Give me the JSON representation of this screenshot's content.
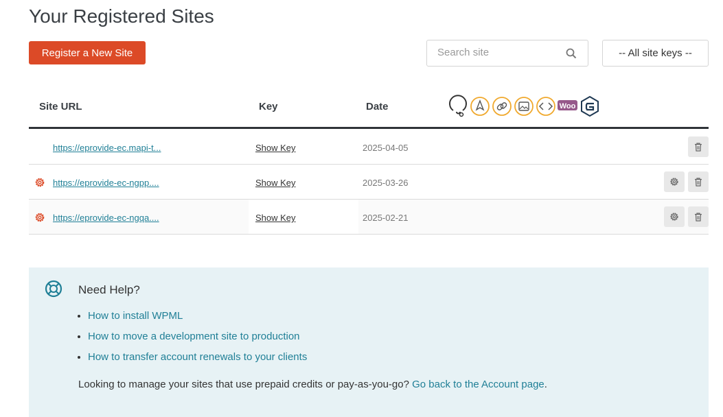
{
  "page": {
    "title": "Your Registered Sites"
  },
  "toolbar": {
    "register_label": "Register a New Site",
    "search_placeholder": "Search site",
    "search_value": "",
    "keys_filter": "-- All site keys --"
  },
  "table": {
    "headers": {
      "url": "Site URL",
      "key": "Key",
      "date": "Date"
    },
    "header_icons": [
      "support-agent-icon",
      "translation-editor-icon",
      "link-icon",
      "image-icon",
      "code-icon",
      "woocommerce-icon",
      "gravity-forms-icon"
    ],
    "rows": [
      {
        "url": "https://eprovide-ec.mapi-t...",
        "key_label": "Show Key",
        "date": "2025-04-05",
        "has_settings": false
      },
      {
        "url": "https://eprovide-ec-ngpp....",
        "key_label": "Show Key",
        "date": "2025-03-26",
        "has_settings": true
      },
      {
        "url": "https://eprovide-ec-ngqa....",
        "key_label": "Show Key",
        "date": "2025-02-21",
        "has_settings": true
      }
    ]
  },
  "help": {
    "title": "Need Help?",
    "links": [
      "How to install WPML",
      "How to move a development site to production",
      "How to transfer account renewals to your clients"
    ],
    "footer_text": "Looking to manage your sites that use prepaid credits or pay-as-you-go?",
    "footer_link": "Go back to the Account page",
    "footer_end": "."
  },
  "colors": {
    "accent": "#dc4a27",
    "link": "#1f7f96",
    "help_bg": "#e7f2f5",
    "icon_orange": "#f0a92e",
    "woo_purple": "#96588a",
    "gravity_navy": "#1e3852"
  },
  "icon_labels": {
    "woo": "Woo"
  }
}
